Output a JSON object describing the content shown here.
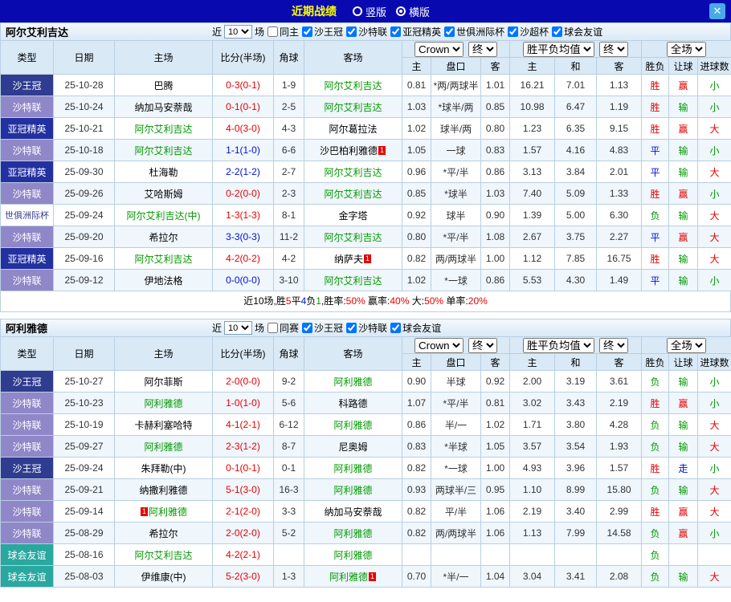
{
  "topbar": {
    "title": "近期战绩",
    "radio_vertical": "竖版",
    "radio_horizontal": "横版",
    "selected_layout": "横版",
    "close": "✕"
  },
  "colors": {
    "topbar_bg": "#0909B0",
    "title_yellow": "#FFFF00",
    "close_bg": "#49A8E8",
    "league_royal_cup": "#2F3C8F",
    "league_saudi_pro": "#9087C8",
    "league_acl_elite": "#2330A0",
    "league_intercontinental_text": "#2F3C8F",
    "league_friendly": "#2AA79F",
    "win_red": "#E80000",
    "draw_blue": "#0010D0",
    "loss_green": "#009900",
    "team_link_green": "#009900",
    "header_bg": "#D9E9F6",
    "row_alt_bg": "#EFF6FC",
    "border": "#B9CFE2"
  },
  "filters_common": {
    "near": "近",
    "near_value": "10",
    "matches": "场"
  },
  "table_header": {
    "col_type": "类型",
    "col_date": "日期",
    "col_home": "主场",
    "col_score": "比分(半场)",
    "col_corner": "角球",
    "col_away": "客场",
    "dd_bookmaker": "Crown",
    "dd_final1": "终",
    "dd_odds": "胜平负均值",
    "dd_final2": "终",
    "dd_scope": "全场",
    "ah_home": "主",
    "ah_line": "盘口",
    "ah_away": "客",
    "eu_home": "主",
    "eu_draw": "和",
    "eu_away": "客",
    "col_result": "胜负",
    "col_handicap": "让球",
    "col_goals": "进球数"
  },
  "sections": [
    {
      "team": "阿尔艾利吉达",
      "checkboxes": [
        {
          "label": "同主",
          "checked": false
        },
        {
          "label": "沙王冠",
          "checked": true
        },
        {
          "label": "沙特联",
          "checked": true
        },
        {
          "label": "亚冠精英",
          "checked": true
        },
        {
          "label": "世俱洲际杯",
          "checked": true
        },
        {
          "label": "沙超杯",
          "checked": true
        },
        {
          "label": "球会友谊",
          "checked": true
        }
      ],
      "rows": [
        {
          "type": "沙王冠",
          "date": "25-10-28",
          "home": {
            "name": "巴腾"
          },
          "score": "0-3(0-1)",
          "corner": "1-9",
          "away": {
            "name": "阿尔艾利吉达",
            "green": true
          },
          "ah": [
            "0.81",
            "*两/两球半",
            "1.01"
          ],
          "eu": [
            "16.21",
            "7.01",
            "1.13"
          ],
          "res": [
            "胜",
            "赢",
            "小"
          ]
        },
        {
          "type": "沙特联",
          "date": "25-10-24",
          "home": {
            "name": "纳加马安萘哉"
          },
          "score": "0-1(0-1)",
          "corner": "2-5",
          "away": {
            "name": "阿尔艾利吉达",
            "green": true
          },
          "ah": [
            "1.03",
            "*球半/两",
            "0.85"
          ],
          "eu": [
            "10.98",
            "6.47",
            "1.19"
          ],
          "res": [
            "胜",
            "输",
            "小"
          ]
        },
        {
          "type": "亚冠精英",
          "date": "25-10-21",
          "home": {
            "name": "阿尔艾利吉达",
            "green": true
          },
          "score": "4-0(3-0)",
          "corner": "4-3",
          "away": {
            "name": "阿尔葛拉法"
          },
          "ah": [
            "1.02",
            "球半/两",
            "0.80"
          ],
          "eu": [
            "1.23",
            "6.35",
            "9.15"
          ],
          "res": [
            "胜",
            "赢",
            "大"
          ]
        },
        {
          "type": "沙特联",
          "date": "25-10-18",
          "home": {
            "name": "阿尔艾利吉达",
            "green": true
          },
          "score": "1-1(1-0)",
          "corner": "6-6",
          "away": {
            "name": "沙巴柏利雅德",
            "badge": "1",
            "badge_pos": "after"
          },
          "ah": [
            "1.05",
            "一球",
            "0.83"
          ],
          "eu": [
            "1.57",
            "4.16",
            "4.83"
          ],
          "res": [
            "平",
            "输",
            "小"
          ]
        },
        {
          "type": "亚冠精英",
          "date": "25-09-30",
          "home": {
            "name": "杜海勒"
          },
          "score": "2-2(1-2)",
          "corner": "2-7",
          "away": {
            "name": "阿尔艾利吉达",
            "green": true
          },
          "ah": [
            "0.96",
            "*平/半",
            "0.86"
          ],
          "eu": [
            "3.13",
            "3.84",
            "2.01"
          ],
          "res": [
            "平",
            "输",
            "大"
          ]
        },
        {
          "type": "沙特联",
          "date": "25-09-26",
          "home": {
            "name": "艾哈斯姆"
          },
          "score": "0-2(0-0)",
          "corner": "2-3",
          "away": {
            "name": "阿尔艾利吉达",
            "green": true
          },
          "ah": [
            "0.85",
            "*球半",
            "1.03"
          ],
          "eu": [
            "7.40",
            "5.09",
            "1.33"
          ],
          "res": [
            "胜",
            "赢",
            "小"
          ]
        },
        {
          "type": "世俱洲际杯",
          "date": "25-09-24",
          "home": {
            "name": "阿尔艾利吉达(中)",
            "green": true
          },
          "score": "1-3(1-3)",
          "corner": "8-1",
          "away": {
            "name": "金字塔"
          },
          "ah": [
            "0.92",
            "球半",
            "0.90"
          ],
          "eu": [
            "1.39",
            "5.00",
            "6.30"
          ],
          "res": [
            "负",
            "输",
            "大"
          ]
        },
        {
          "type": "沙特联",
          "date": "25-09-20",
          "home": {
            "name": "希拉尔"
          },
          "score": "3-3(0-3)",
          "corner": "11-2",
          "away": {
            "name": "阿尔艾利吉达",
            "green": true
          },
          "ah": [
            "0.80",
            "*平/半",
            "1.08"
          ],
          "eu": [
            "2.67",
            "3.75",
            "2.27"
          ],
          "res": [
            "平",
            "赢",
            "大"
          ]
        },
        {
          "type": "亚冠精英",
          "date": "25-09-16",
          "home": {
            "name": "阿尔艾利吉达",
            "green": true
          },
          "score": "4-2(0-2)",
          "corner": "4-2",
          "away": {
            "name": "纳萨夫",
            "badge": "1",
            "badge_pos": "after"
          },
          "ah": [
            "0.82",
            "两/两球半",
            "1.00"
          ],
          "eu": [
            "1.12",
            "7.85",
            "16.75"
          ],
          "res": [
            "胜",
            "输",
            "大"
          ]
        },
        {
          "type": "沙特联",
          "date": "25-09-12",
          "home": {
            "name": "伊地法格"
          },
          "score": "0-0(0-0)",
          "corner": "3-10",
          "away": {
            "name": "阿尔艾利吉达",
            "green": true
          },
          "ah": [
            "1.02",
            "*一球",
            "0.86"
          ],
          "eu": [
            "5.53",
            "4.30",
            "1.49"
          ],
          "res": [
            "平",
            "输",
            "小"
          ]
        }
      ],
      "summary": [
        {
          "t": "近10场,胜",
          "c": "k"
        },
        {
          "t": "5",
          "c": "r"
        },
        {
          "t": "平",
          "c": "k"
        },
        {
          "t": "4",
          "c": "b"
        },
        {
          "t": "负",
          "c": "k"
        },
        {
          "t": "1",
          "c": "g"
        },
        {
          "t": ",胜率:",
          "c": "k"
        },
        {
          "t": "50%",
          "c": "r"
        },
        {
          "t": "  赢率:",
          "c": "k"
        },
        {
          "t": "40%",
          "c": "r"
        },
        {
          "t": "  大:",
          "c": "k"
        },
        {
          "t": "50%",
          "c": "r"
        },
        {
          "t": "  单率:",
          "c": "k"
        },
        {
          "t": "20%",
          "c": "r"
        }
      ]
    },
    {
      "team": "阿利雅德",
      "checkboxes": [
        {
          "label": "同赛",
          "checked": false
        },
        {
          "label": "沙王冠",
          "checked": true
        },
        {
          "label": "沙特联",
          "checked": true
        },
        {
          "label": "球会友谊",
          "checked": true
        }
      ],
      "rows": [
        {
          "type": "沙王冠",
          "date": "25-10-27",
          "home": {
            "name": "阿尔菲斯"
          },
          "score": "2-0(0-0)",
          "corner": "9-2",
          "away": {
            "name": "阿利雅德",
            "green": true
          },
          "ah": [
            "0.90",
            "半球",
            "0.92"
          ],
          "eu": [
            "2.00",
            "3.19",
            "3.61"
          ],
          "res": [
            "负",
            "输",
            "小"
          ]
        },
        {
          "type": "沙特联",
          "date": "25-10-23",
          "home": {
            "name": "阿利雅德",
            "green": true
          },
          "score": "1-0(1-0)",
          "corner": "5-6",
          "away": {
            "name": "科路德"
          },
          "ah": [
            "1.07",
            "*平/半",
            "0.81"
          ],
          "eu": [
            "3.02",
            "3.43",
            "2.19"
          ],
          "res": [
            "胜",
            "赢",
            "小"
          ]
        },
        {
          "type": "沙特联",
          "date": "25-10-19",
          "home": {
            "name": "卡赫利塞哈特"
          },
          "score": "4-1(2-1)",
          "corner": "6-12",
          "away": {
            "name": "阿利雅德",
            "green": true
          },
          "ah": [
            "0.86",
            "半/一",
            "1.02"
          ],
          "eu": [
            "1.71",
            "3.80",
            "4.28"
          ],
          "res": [
            "负",
            "输",
            "大"
          ]
        },
        {
          "type": "沙特联",
          "date": "25-09-27",
          "home": {
            "name": "阿利雅德",
            "green": true
          },
          "score": "2-3(1-2)",
          "corner": "8-7",
          "away": {
            "name": "尼奥姆"
          },
          "ah": [
            "0.83",
            "*半球",
            "1.05"
          ],
          "eu": [
            "3.57",
            "3.54",
            "1.93"
          ],
          "res": [
            "负",
            "输",
            "大"
          ]
        },
        {
          "type": "沙王冠",
          "date": "25-09-24",
          "home": {
            "name": "朱拜勒(中)"
          },
          "score": "0-1(0-1)",
          "corner": "0-1",
          "away": {
            "name": "阿利雅德",
            "green": true
          },
          "ah": [
            "0.82",
            "*一球",
            "1.00"
          ],
          "eu": [
            "4.93",
            "3.96",
            "1.57"
          ],
          "res": [
            "胜",
            "走",
            "小"
          ]
        },
        {
          "type": "沙特联",
          "date": "25-09-21",
          "home": {
            "name": "纳撒利雅德"
          },
          "score": "5-1(3-0)",
          "corner": "16-3",
          "away": {
            "name": "阿利雅德",
            "green": true
          },
          "ah": [
            "0.93",
            "两球半/三",
            "0.95"
          ],
          "eu": [
            "1.10",
            "8.99",
            "15.80"
          ],
          "res": [
            "负",
            "输",
            "大"
          ]
        },
        {
          "type": "沙特联",
          "date": "25-09-14",
          "home": {
            "name": "阿利雅德",
            "green": true,
            "badge": "1",
            "badge_pos": "before"
          },
          "score": "2-1(2-0)",
          "corner": "3-3",
          "away": {
            "name": "纳加马安萘哉"
          },
          "ah": [
            "0.82",
            "平/半",
            "1.06"
          ],
          "eu": [
            "2.19",
            "3.40",
            "2.99"
          ],
          "res": [
            "胜",
            "赢",
            "大"
          ]
        },
        {
          "type": "沙特联",
          "date": "25-08-29",
          "home": {
            "name": "希拉尔"
          },
          "score": "2-0(2-0)",
          "corner": "5-2",
          "away": {
            "name": "阿利雅德",
            "green": true
          },
          "ah": [
            "0.82",
            "两/两球半",
            "1.06"
          ],
          "eu": [
            "1.13",
            "7.99",
            "14.58"
          ],
          "res": [
            "负",
            "赢",
            "小"
          ]
        },
        {
          "type": "球会友谊",
          "date": "25-08-16",
          "home": {
            "name": "阿尔艾利吉达",
            "green": true
          },
          "score": "4-2(2-1)",
          "corner": "",
          "away": {
            "name": "阿利雅德",
            "green": true
          },
          "ah": [
            "",
            "",
            ""
          ],
          "eu": [
            "",
            "",
            ""
          ],
          "res": [
            "负",
            "",
            ""
          ]
        },
        {
          "type": "球会友谊",
          "date": "25-08-03",
          "home": {
            "name": "伊维康(中)"
          },
          "score": "5-2(3-0)",
          "corner": "1-3",
          "away": {
            "name": "阿利雅德",
            "green": true,
            "badge": "1",
            "badge_pos": "after"
          },
          "ah": [
            "0.70",
            "*半/一",
            "1.04"
          ],
          "eu": [
            "3.04",
            "3.41",
            "2.08"
          ],
          "res": [
            "负",
            "输",
            "大"
          ]
        }
      ]
    }
  ]
}
